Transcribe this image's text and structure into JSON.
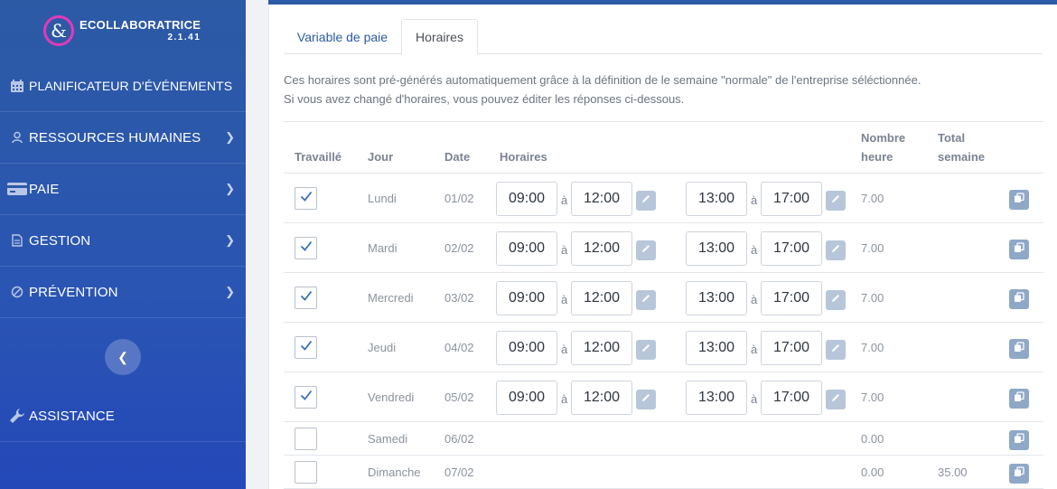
{
  "app": {
    "name": "ECOLLABORATRICE",
    "version": "2.1.41"
  },
  "sidebar": {
    "items": [
      {
        "label": "PLANIFICATEUR D'ÉVÉNEMENTS",
        "icon": "calendar-icon"
      },
      {
        "label": "RESSOURCES HUMAINES",
        "icon": "user-icon"
      },
      {
        "label": "PAIE",
        "icon": "credit-card-icon"
      },
      {
        "label": "GESTION",
        "icon": "document-icon"
      },
      {
        "label": "PRÉVENTION",
        "icon": "ban-icon"
      },
      {
        "label": "ASSISTANCE",
        "icon": "wrench-icon"
      }
    ],
    "collapse_icon": "chevron-left-icon"
  },
  "tabs": [
    {
      "label": "Variable de paie",
      "active": false
    },
    {
      "label": "Horaires",
      "active": true
    }
  ],
  "description": {
    "line1": "Ces horaires sont pré-générés automatiquement grâce à la définition de le semaine \"normale\" de l'entreprise séléctionnée.",
    "line2": "Si vous avez changé d'horaires, vous pouvez éditer les réponses ci-dessous."
  },
  "table": {
    "headers": {
      "travaille": "Travaillé",
      "jour": "Jour",
      "date": "Date",
      "horaires": "Horaires",
      "nombre_heure_1": "Nombre",
      "nombre_heure_2": "heure",
      "total_semaine_1": "Total",
      "total_semaine_2": "semaine"
    },
    "separator": "à",
    "rows": [
      {
        "checked": true,
        "jour": "Lundi",
        "date": "01/02",
        "am_start": "09:00",
        "am_end": "12:00",
        "pm_start": "13:00",
        "pm_end": "17:00",
        "hours": "7.00",
        "total": ""
      },
      {
        "checked": true,
        "jour": "Mardi",
        "date": "02/02",
        "am_start": "09:00",
        "am_end": "12:00",
        "pm_start": "13:00",
        "pm_end": "17:00",
        "hours": "7.00",
        "total": ""
      },
      {
        "checked": true,
        "jour": "Mercredi",
        "date": "03/02",
        "am_start": "09:00",
        "am_end": "12:00",
        "pm_start": "13:00",
        "pm_end": "17:00",
        "hours": "7.00",
        "total": ""
      },
      {
        "checked": true,
        "jour": "Jeudi",
        "date": "04/02",
        "am_start": "09:00",
        "am_end": "12:00",
        "pm_start": "13:00",
        "pm_end": "17:00",
        "hours": "7.00",
        "total": ""
      },
      {
        "checked": true,
        "jour": "Vendredi",
        "date": "05/02",
        "am_start": "09:00",
        "am_end": "12:00",
        "pm_start": "13:00",
        "pm_end": "17:00",
        "hours": "7.00",
        "total": ""
      },
      {
        "checked": false,
        "jour": "Samedi",
        "date": "06/02",
        "hours": "0.00",
        "total": ""
      },
      {
        "checked": false,
        "jour": "Dimanche",
        "date": "07/02",
        "hours": "0.00",
        "total": "35.00"
      }
    ]
  },
  "colors": {
    "sidebar": "#2d5aa5",
    "accent": "#2c5aa0",
    "logo_ring": "#e23ab8",
    "check": "#3b6fb6"
  }
}
